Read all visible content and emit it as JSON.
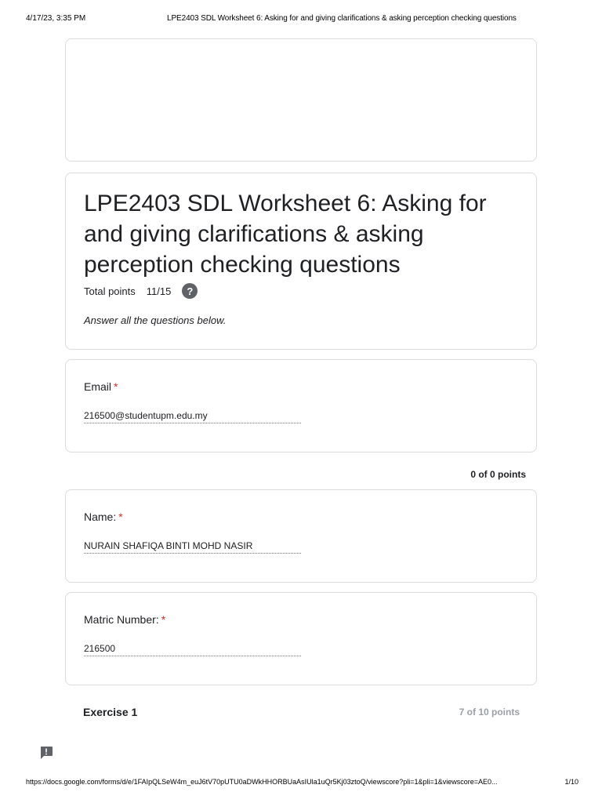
{
  "print_header": {
    "date": "4/17/23, 3:35 PM",
    "title": "LPE2403 SDL Worksheet 6: Asking for and giving clarifications & asking perception checking questions"
  },
  "form": {
    "title": "LPE2403 SDL Worksheet 6:  Asking for and giving clarifications & asking perception checking questions",
    "total_points_label": "Total points",
    "total_points_value": "11/15",
    "help_icon": "help-circle-icon",
    "description": "Answer all the questions below."
  },
  "questions": {
    "email": {
      "label": "Email",
      "required_mark": "*",
      "value": "216500@studentupm.edu.my"
    },
    "name": {
      "label": "Name:",
      "required_mark": "*",
      "value": "NURAIN SHAFIQA BINTI MOHD NASIR"
    },
    "matric": {
      "label": "Matric Number:",
      "required_mark": "*",
      "value": "216500"
    }
  },
  "section_points": "0 of 0 points",
  "exercise": {
    "title": "Exercise 1",
    "points": "7 of 10 points"
  },
  "feedback_icon": "report-feedback-icon",
  "print_footer": {
    "url": "https://docs.google.com/forms/d/e/1FAIpQLSeW4m_euJ6tV70pUTU0aDWkHHORBUaAsIUla1uQr5Kj03ztoQ/viewscore?pli=1&pli=1&viewscore=AE0...",
    "page": "1/10"
  },
  "colors": {
    "required": "#d93025",
    "border": "#dadce0",
    "muted_points": "#9aa0a6",
    "icon_gray": "#5f6368"
  }
}
